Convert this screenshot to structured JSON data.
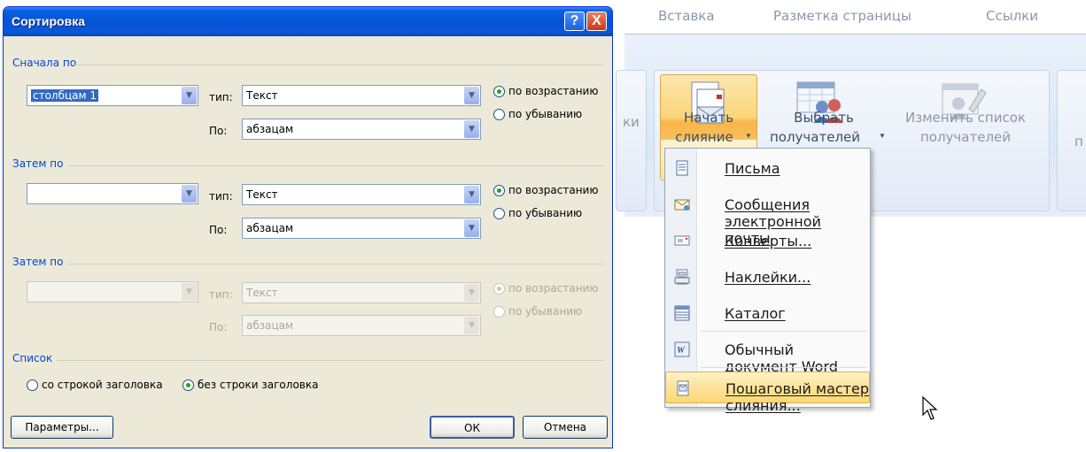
{
  "dialog": {
    "title": "Сортировка",
    "help_glyph": "?",
    "close_glyph": "X",
    "sections": [
      {
        "label": "Сначала по",
        "column": "столбцам 1",
        "type_label": "тип:",
        "type_value": "Текст",
        "by_label": "По:",
        "by_value": "абзацам",
        "asc": "по возрастанию",
        "desc": "по убыванию",
        "asc_checked": true,
        "disabled": false
      },
      {
        "label": "Затем по",
        "column": "",
        "type_label": "тип:",
        "type_value": "Текст",
        "by_label": "По:",
        "by_value": "абзацам",
        "asc": "по возрастанию",
        "desc": "по убыванию",
        "asc_checked": true,
        "disabled": false
      },
      {
        "label": "Затем по",
        "column": "",
        "type_label": "тип:",
        "type_value": "Текст",
        "by_label": "По:",
        "by_value": "абзацам",
        "asc": "по возрастанию",
        "desc": "по убыванию",
        "asc_checked": true,
        "disabled": true
      }
    ],
    "list_label": "Список",
    "with_header": "со строкой заголовка",
    "without_header": "без строки заголовка",
    "without_header_checked": true,
    "params_button": "Параметры...",
    "ok_button": "ОК",
    "cancel_button": "Отмена"
  },
  "ribbon": {
    "tabs": [
      "Вставка",
      "Разметка страницы",
      "Ссылки"
    ],
    "left_cut": "ки",
    "right_cut": "п",
    "start": {
      "line1": "Начать",
      "line2": "слияние"
    },
    "select": {
      "line1": "Выбрать",
      "line2": "получателей"
    },
    "edit": {
      "line1": "Изменить список",
      "line2": "получателей"
    }
  },
  "menu": {
    "items": [
      {
        "label": "Письма",
        "icon": "letter-icon"
      },
      {
        "label": "Сообщения электронной почты",
        "icon": "email-icon"
      },
      {
        "label": "Конверты...",
        "icon": "envelope-icon"
      },
      {
        "label": "Наклейки...",
        "icon": "labels-icon"
      },
      {
        "label": "Каталог",
        "icon": "catalog-icon"
      },
      {
        "label": "Обычный документ Word",
        "icon": "word-doc-icon"
      },
      {
        "label": "Пошаговый мастер слияния...",
        "icon": "wizard-icon"
      }
    ]
  },
  "colors": {
    "accent_blue": "#0046d5",
    "highlight": "#fdd774",
    "title_bar": "#0553d6"
  }
}
